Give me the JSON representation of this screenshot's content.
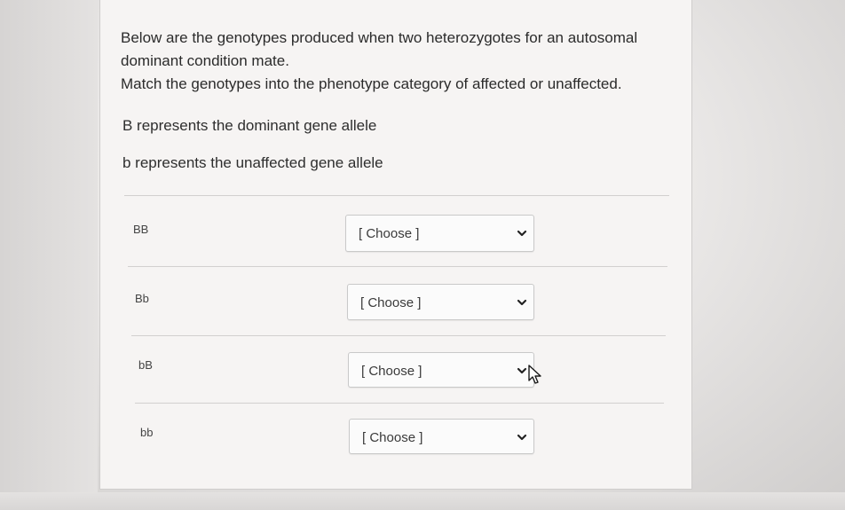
{
  "question": {
    "line1": "Below are the genotypes produced when two heterozygotes for an autosomal",
    "line2": "dominant condition mate.",
    "line3": "Match the genotypes into the phenotype category of affected or unaffected."
  },
  "notes": {
    "dominant": "B represents the dominant gene allele",
    "unaffected": "b represents the unaffected gene allele"
  },
  "answers": [
    {
      "genotype": "BB",
      "selected": "[ Choose ]"
    },
    {
      "genotype": "Bb",
      "selected": "[ Choose ]"
    },
    {
      "genotype": "bB",
      "selected": "[ Choose ]"
    },
    {
      "genotype": "bb",
      "selected": "[ Choose ]"
    }
  ],
  "icons": {
    "dropdown": "chevron-down-icon",
    "cursor": "mouse-pointer-icon"
  }
}
